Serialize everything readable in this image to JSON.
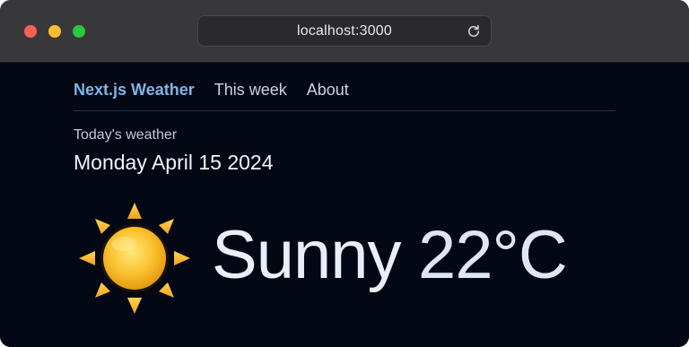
{
  "browser": {
    "url": "localhost:3000"
  },
  "nav": {
    "brand": "Next.js Weather",
    "links": [
      "This week",
      "About"
    ]
  },
  "weather": {
    "subtitle": "Today's weather",
    "date": "Monday April 15 2024",
    "condition": "Sunny",
    "temperature": "22°C",
    "icon": "sun-icon"
  },
  "colors": {
    "page_background": "#040814",
    "brand_accent": "#7fb6e6",
    "titlebar": "#38383b"
  }
}
